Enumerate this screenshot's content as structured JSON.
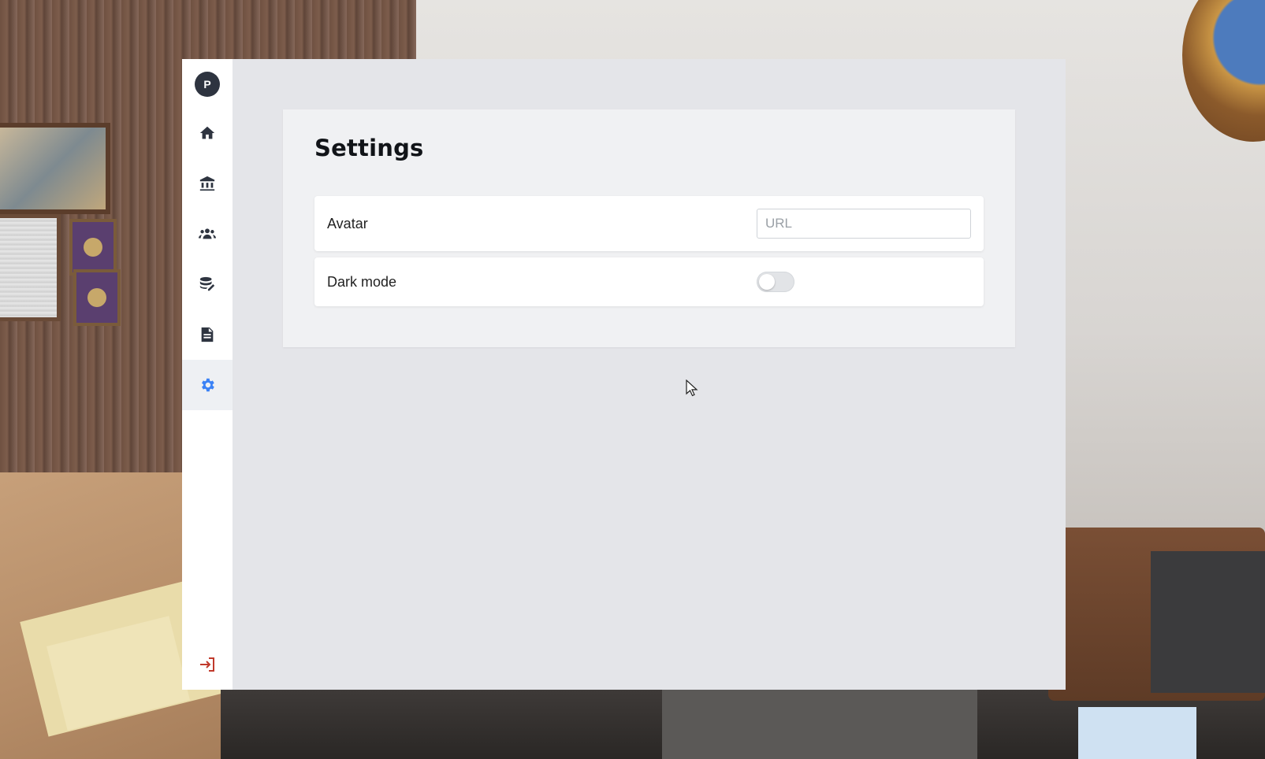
{
  "sidebar": {
    "avatar_initial": "P",
    "items": [
      {
        "name": "home",
        "icon": "home-icon",
        "active": false
      },
      {
        "name": "bank",
        "icon": "bank-icon",
        "active": false
      },
      {
        "name": "people",
        "icon": "users-icon",
        "active": false
      },
      {
        "name": "database",
        "icon": "database-edit-icon",
        "active": false
      },
      {
        "name": "documents",
        "icon": "document-icon",
        "active": false
      },
      {
        "name": "settings",
        "icon": "gear-icon",
        "active": true
      }
    ],
    "logout_icon": "logout-icon"
  },
  "settings": {
    "title": "Settings",
    "avatar_label": "Avatar",
    "avatar_value": "",
    "avatar_placeholder": "URL",
    "dark_mode_label": "Dark mode",
    "dark_mode_enabled": false
  },
  "colors": {
    "accent": "#3b82f6",
    "logout": "#c0392b",
    "sidebar_icon": "#2e3440"
  }
}
